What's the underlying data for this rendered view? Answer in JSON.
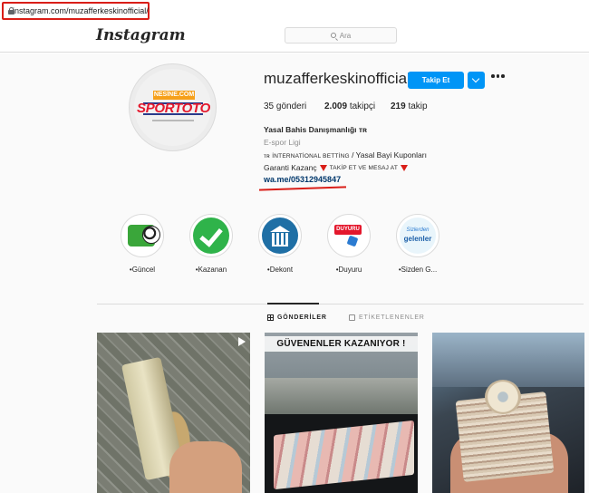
{
  "browser": {
    "url": "instagram.com/muzafferkeskinofficial/"
  },
  "header": {
    "logo": "Instagram",
    "search_placeholder": "Ara"
  },
  "avatar": {
    "top_text": "NESİNE.COM",
    "main_text": "SPORTOTO"
  },
  "profile": {
    "username": "muzafferkeskinofficial",
    "follow_label": "Takip Et",
    "stats": [
      {
        "count": "35",
        "label": "gönderi"
      },
      {
        "count": "2.009",
        "label": "takipçi"
      },
      {
        "count": "219",
        "label": "takip"
      }
    ]
  },
  "bio": {
    "name": "Yasal Bahis Danışmanlığı ᴛʀ",
    "category": "E-spor Ligi",
    "line1_prefix": "ᴛʀ",
    "line1_sc": "İNTERNATİONAL BETTİNG",
    "line1_rest": " / Yasal Bayi Kuponları",
    "line2_text": "Garanti Kazanç",
    "line2_sc": "TAKİP ET VE MESAJ AT",
    "link": "wa.me/05312945847"
  },
  "highlights": [
    {
      "label": "•Güncel",
      "icon": "soccer-ball-icon"
    },
    {
      "label": "•Kazanan",
      "icon": "check-mark-icon"
    },
    {
      "label": "•Dekont",
      "icon": "bank-icon"
    },
    {
      "label": "•Duyuru",
      "icon": "announcement-icon",
      "badge": "DUYURU"
    },
    {
      "label": "•Sizden G...",
      "icon": "testimonials-icon",
      "line1": "Sizlerden",
      "line2": "gelenler"
    }
  ],
  "tabs": [
    {
      "label": "GÖNDERİLER",
      "active": true
    },
    {
      "label": "ETİKETLENENLER",
      "active": false
    }
  ],
  "posts": [
    {
      "kind": "video",
      "caption": ""
    },
    {
      "kind": "image",
      "caption": "GÜVENENLER KAZANIYOR !"
    },
    {
      "kind": "image",
      "caption": ""
    }
  ],
  "colors": {
    "accent": "#0095f6",
    "annotation_red": "#d91e18",
    "link": "#00376b"
  }
}
